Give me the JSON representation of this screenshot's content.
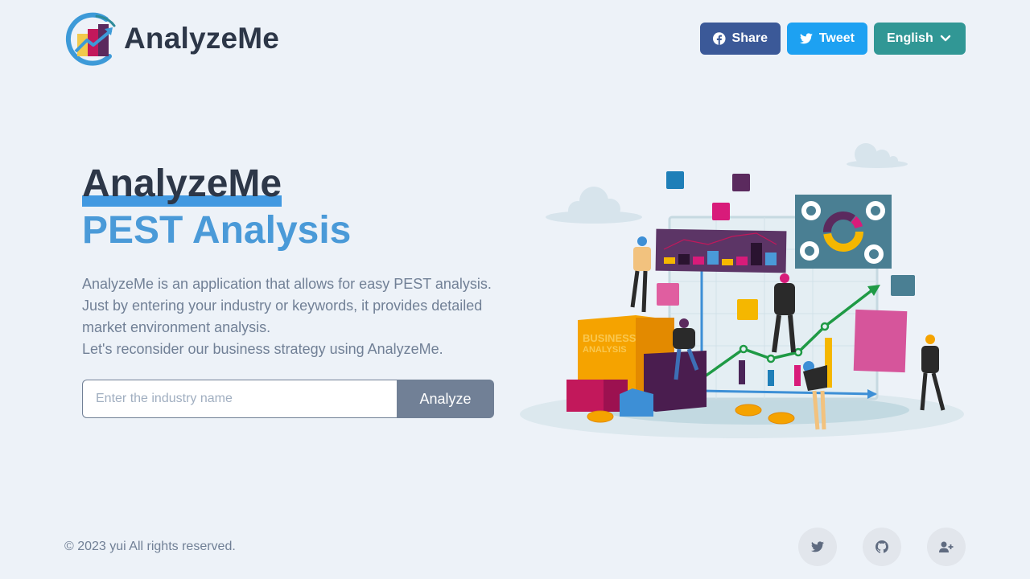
{
  "header": {
    "brand_name": "AnalyzeMe",
    "share_label": "Share",
    "tweet_label": "Tweet",
    "language_label": "English",
    "colors": {
      "facebook": "#3b5998",
      "twitter": "#1da1f2",
      "language": "#319795"
    }
  },
  "hero": {
    "title_line1": "AnalyzeMe",
    "title_line2": "PEST Analysis",
    "description": [
      "AnalyzeMe is an application that allows for easy PEST analysis.",
      "Just by entering your industry or keywords, it provides detailed",
      "market environment analysis.",
      "Let's reconsider our business strategy using AnalyzeMe."
    ],
    "search": {
      "value": "",
      "placeholder": "Enter the industry name"
    },
    "analyze_label": "Analyze",
    "illustration": {
      "alt": "business analysis illustration",
      "block_text_1": "BUSINESS",
      "block_text_2": "ANALYSIS"
    }
  },
  "footer": {
    "copyright": "© 2023 yui All rights reserved.",
    "icons": [
      "twitter-icon",
      "github-icon",
      "user-plus-icon"
    ]
  }
}
